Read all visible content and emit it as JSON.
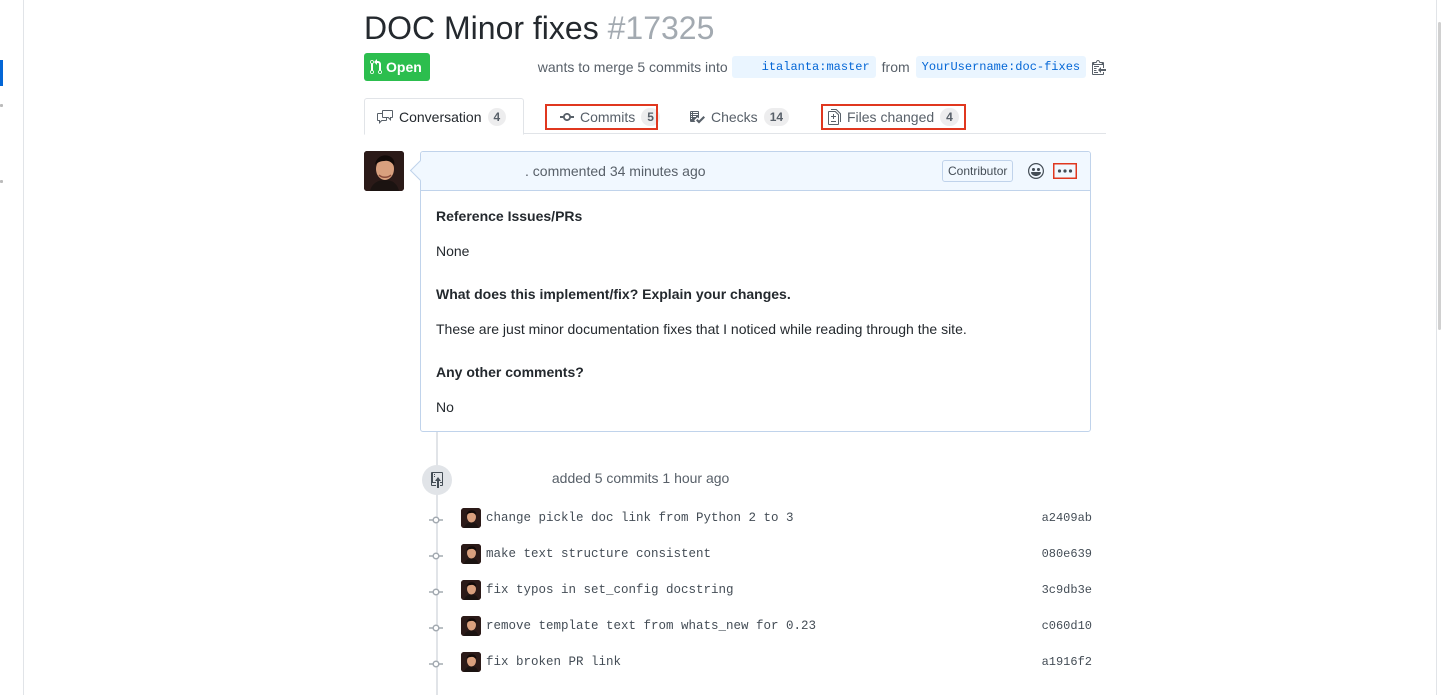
{
  "pr": {
    "title": "DOC Minor fixes",
    "number": "#17325",
    "state": "Open",
    "merge_text": "wants to merge 5 commits into",
    "base_ref": "italanta:master",
    "from_word": "from",
    "head_ref": "YourUsername:doc-fixes"
  },
  "tabs": [
    {
      "label": "Conversation",
      "count": "4",
      "icon": "comment-discussion-icon"
    },
    {
      "label": "Commits",
      "count": "5",
      "icon": "git-commit-icon"
    },
    {
      "label": "Checks",
      "count": "14",
      "icon": "checklist-icon"
    },
    {
      "label": "Files changed",
      "count": "4",
      "icon": "file-diff-icon"
    }
  ],
  "comment": {
    "action": ". commented 34 minutes ago",
    "role_badge": "Contributor",
    "body": [
      {
        "heading": "Reference Issues/PRs"
      },
      {
        "text": "None"
      },
      {
        "heading": "What does this implement/fix? Explain your changes."
      },
      {
        "text": "These are just minor documentation fixes that I noticed while reading through the site."
      },
      {
        "heading": "Any other comments?"
      },
      {
        "text": "No"
      }
    ]
  },
  "event": {
    "text": "added 5 commits 1 hour ago"
  },
  "commits": [
    {
      "message": "change pickle doc link from Python 2 to 3",
      "sha": "a2409ab"
    },
    {
      "message": "make text structure consistent",
      "sha": "080e639"
    },
    {
      "message": "fix typos in set_config docstring",
      "sha": "3c9db3e"
    },
    {
      "message": "remove template text from whats_new for 0.23",
      "sha": "c060d10"
    },
    {
      "message": "fix broken PR link",
      "sha": "a1916f2"
    }
  ],
  "colors": {
    "open_green": "#2cbe4e",
    "link_blue": "#0366d6",
    "highlight_red": "#e0371f",
    "comment_header_bg": "#f1f8ff"
  }
}
